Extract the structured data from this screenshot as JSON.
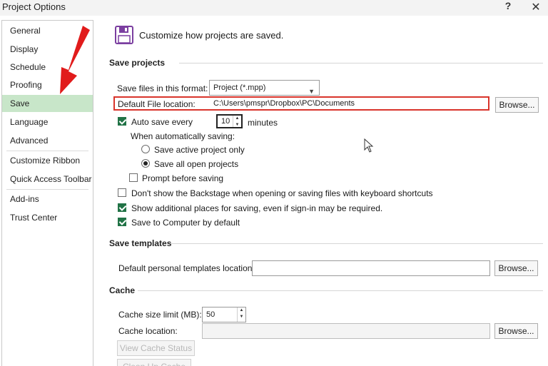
{
  "window": {
    "title": "Project Options",
    "help_label": "?",
    "close_label": "✕"
  },
  "sidebar": {
    "items": [
      {
        "label": "General"
      },
      {
        "label": "Display"
      },
      {
        "label": "Schedule"
      },
      {
        "label": "Proofing"
      },
      {
        "label": "Save",
        "selected": true
      },
      {
        "label": "Language"
      },
      {
        "label": "Advanced"
      },
      {
        "label": "Customize Ribbon"
      },
      {
        "label": "Quick Access Toolbar"
      },
      {
        "label": "Add-ins"
      },
      {
        "label": "Trust Center"
      }
    ]
  },
  "header": {
    "text": "Customize how projects are saved.",
    "icon": "floppy-disk-icon"
  },
  "save_projects": {
    "title": "Save projects",
    "format_label": "Save files in this format:",
    "format_value": "Project (*.mpp)",
    "location_label": "Default File location:",
    "location_value": "C:\\Users\\pmspr\\Dropbox\\PC\\Documents",
    "browse_label": "Browse...",
    "autosave_label": "Auto save every",
    "autosave_checked": true,
    "autosave_value": "10",
    "autosave_unit": "minutes",
    "when_label": "When automatically saving:",
    "radio_active": "Save active project only",
    "radio_all": "Save all open projects",
    "prompt_label": "Prompt before saving",
    "backstage_label": "Don't show the Backstage when opening or saving files with keyboard shortcuts",
    "additional_label": "Show additional places for saving, even if sign-in may be required.",
    "computer_label": "Save to Computer by default"
  },
  "save_templates": {
    "title": "Save templates",
    "location_label": "Default personal templates location:",
    "location_value": "",
    "browse_label": "Browse..."
  },
  "cache": {
    "title": "Cache",
    "size_label": "Cache size limit (MB):",
    "size_value": "50",
    "location_label": "Cache location:",
    "location_value": "",
    "browse_label": "Browse...",
    "view_status_label": "View Cache Status",
    "clean_up_label": "Clean Up Cache"
  },
  "colors": {
    "selected_nav": "#c8e6c9",
    "check_green": "#217346",
    "highlight_red": "#d9342b",
    "arrow_red": "#e11b1b",
    "icon_purple": "#7b3fa0"
  }
}
